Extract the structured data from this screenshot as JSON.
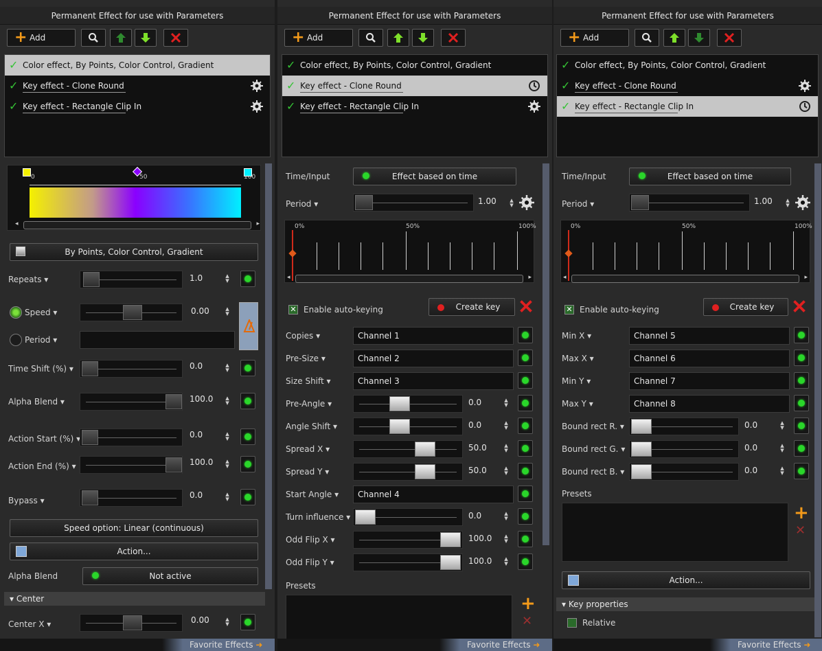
{
  "panel_title": "Permanent Effect for use with Parameters",
  "toolbar": {
    "add_label": "Add"
  },
  "effects": [
    "Color effect, By Points, Color Control, Gradient",
    "Key effect - Clone Round",
    "Key effect - Rectangle Clip In"
  ],
  "favorites_label": "Favorite Effects",
  "colors": {
    "accent_green": "#2ad62a",
    "orange": "#f39a1a",
    "red": "#e02020",
    "selection": "#c6c6c6"
  },
  "left": {
    "gradient": {
      "mark_start": "0",
      "mark_mid": "50",
      "mark_end": "100",
      "colors": [
        "#f4f000",
        "#8a00ff",
        "#00f0ff"
      ]
    },
    "color_control_label": "By Points, Color Control, Gradient",
    "repeats": {
      "label": "Repeats ▾",
      "value": "1.0"
    },
    "speed": {
      "label": "Speed ▾",
      "value": "0.00"
    },
    "period": {
      "label": "Period ▾"
    },
    "time_shift": {
      "label": "Time Shift (%) ▾",
      "value": "0.0"
    },
    "alpha_blend": {
      "label": "Alpha Blend ▾",
      "value": "100.0"
    },
    "action_start": {
      "label": "Action Start (%) ▾",
      "value": "0.0"
    },
    "action_end": {
      "label": "Action End (%) ▾",
      "value": "100.0"
    },
    "bypass": {
      "label": "Bypass ▾",
      "value": "0.0"
    },
    "speed_option": "Speed option: Linear (continuous)",
    "action_label": "Action...",
    "alpha_blend_row": {
      "label": "Alpha Blend",
      "value": "Not active"
    },
    "center_section": "▾ Center",
    "center_x": {
      "label": "Center X ▾",
      "value": "0.00"
    }
  },
  "middle": {
    "time_input_label": "Time/Input",
    "effect_based": "Effect based on time",
    "period": {
      "label": "Period ▾",
      "value": "1.00"
    },
    "timeline_labels": [
      "0%",
      "50%",
      "100%"
    ],
    "auto_keying": "Enable auto-keying",
    "create_key": "Create key",
    "rows": [
      {
        "label": "Copies ▾",
        "type": "channel",
        "value": "Channel 1"
      },
      {
        "label": "Pre-Size ▾",
        "type": "channel",
        "value": "Channel 2"
      },
      {
        "label": "Size Shift ▾",
        "type": "channel",
        "value": "Channel 3"
      },
      {
        "label": "Pre-Angle ▾",
        "type": "slider",
        "value": "0.0",
        "pos": 0.4
      },
      {
        "label": "Angle Shift ▾",
        "type": "slider",
        "value": "0.0",
        "pos": 0.4
      },
      {
        "label": "Spread X ▾",
        "type": "slider",
        "value": "50.0",
        "pos": 0.7
      },
      {
        "label": "Spread Y ▾",
        "type": "slider",
        "value": "50.0",
        "pos": 0.7
      },
      {
        "label": "Start Angle ▾",
        "type": "channel",
        "value": "Channel 4"
      },
      {
        "label": "Turn influence ▾",
        "type": "slider",
        "value": "0.0",
        "pos": 0.0
      },
      {
        "label": "Odd Flip X ▾",
        "type": "slider",
        "value": "100.0",
        "pos": 1.0
      },
      {
        "label": "Odd Flip Y ▾",
        "type": "slider",
        "value": "100.0",
        "pos": 1.0
      }
    ],
    "presets_label": "Presets"
  },
  "right": {
    "time_input_label": "Time/Input",
    "effect_based": "Effect based on time",
    "period": {
      "label": "Period ▾",
      "value": "1.00"
    },
    "timeline_labels": [
      "0%",
      "50%",
      "100%"
    ],
    "auto_keying": "Enable auto-keying",
    "create_key": "Create key",
    "rows": [
      {
        "label": "Min X ▾",
        "type": "channel",
        "value": "Channel 5"
      },
      {
        "label": "Max X ▾",
        "type": "channel",
        "value": "Channel 6"
      },
      {
        "label": "Min Y ▾",
        "type": "channel",
        "value": "Channel 7"
      },
      {
        "label": "Max Y ▾",
        "type": "channel",
        "value": "Channel 8"
      },
      {
        "label": "Bound rect R. ▾",
        "type": "slider",
        "value": "0.0",
        "pos": 0.0
      },
      {
        "label": "Bound rect G. ▾",
        "type": "slider",
        "value": "0.0",
        "pos": 0.0
      },
      {
        "label": "Bound rect B. ▾",
        "type": "slider",
        "value": "0.0",
        "pos": 0.0
      }
    ],
    "presets_label": "Presets",
    "action_label": "Action...",
    "key_properties": "▾ Key properties",
    "relative": "Relative"
  }
}
